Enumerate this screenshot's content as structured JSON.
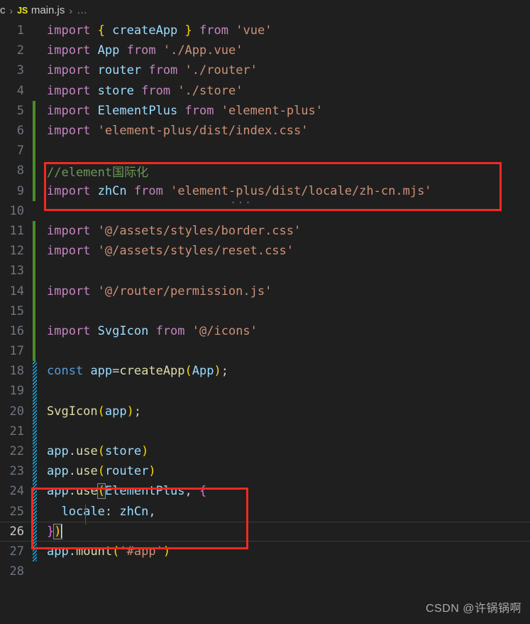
{
  "breadcrumb": {
    "path_prefix": "c",
    "file_icon_label": "JS",
    "file_name": "main.js",
    "separator": "›",
    "trailing": "…"
  },
  "editor": {
    "active_line_number": 26,
    "cursor_line": 26,
    "language": "javascript",
    "theme_background": "#1f1f1f",
    "gutter_green_color": "#4b8b28",
    "gutter_hatch_color": "#1f9ed0",
    "annotation_color": "#f02a21",
    "lines": [
      {
        "n": "1",
        "gutter": "none",
        "text": "import { createApp } from 'vue'"
      },
      {
        "n": "2",
        "gutter": "none",
        "text": "import App from './App.vue'"
      },
      {
        "n": "3",
        "gutter": "none",
        "text": "import router from './router'"
      },
      {
        "n": "4",
        "gutter": "none",
        "text": "import store from './store'"
      },
      {
        "n": "5",
        "gutter": "green",
        "text": "import ElementPlus from 'element-plus'"
      },
      {
        "n": "6",
        "gutter": "green",
        "text": "import 'element-plus/dist/index.css'"
      },
      {
        "n": "7",
        "gutter": "green",
        "text": ""
      },
      {
        "n": "8",
        "gutter": "green",
        "text": "//element国际化"
      },
      {
        "n": "9",
        "gutter": "green",
        "text": "import zhCn from 'element-plus/dist/locale/zh-cn.mjs'"
      },
      {
        "n": "10",
        "gutter": "none",
        "text": ""
      },
      {
        "n": "11",
        "gutter": "green",
        "text": "import '@/assets/styles/border.css'"
      },
      {
        "n": "12",
        "gutter": "green",
        "text": "import '@/assets/styles/reset.css'"
      },
      {
        "n": "13",
        "gutter": "green",
        "text": ""
      },
      {
        "n": "14",
        "gutter": "green",
        "text": "import '@/router/permission.js'"
      },
      {
        "n": "15",
        "gutter": "green",
        "text": ""
      },
      {
        "n": "16",
        "gutter": "green",
        "text": "import SvgIcon from '@/icons'"
      },
      {
        "n": "17",
        "gutter": "green",
        "text": ""
      },
      {
        "n": "18",
        "gutter": "hatch",
        "text": "const app=createApp(App);"
      },
      {
        "n": "19",
        "gutter": "hatch",
        "text": ""
      },
      {
        "n": "20",
        "gutter": "hatch",
        "text": "SvgIcon(app);"
      },
      {
        "n": "21",
        "gutter": "hatch",
        "text": ""
      },
      {
        "n": "22",
        "gutter": "hatch",
        "text": "app.use(store)"
      },
      {
        "n": "23",
        "gutter": "hatch",
        "text": "app.use(router)"
      },
      {
        "n": "24",
        "gutter": "hatch",
        "text": "app.use(ElementPlus, {"
      },
      {
        "n": "25",
        "gutter": "hatch",
        "text": "  locale: zhCn,"
      },
      {
        "n": "26",
        "gutter": "hatch",
        "text": "})"
      },
      {
        "n": "27",
        "gutter": "hatch",
        "text": "app.mount('#app')"
      },
      {
        "n": "28",
        "gutter": "none",
        "text": ""
      }
    ]
  },
  "annotations": [
    {
      "label": "highlight-box-import-zhcn",
      "lines": "8-9"
    },
    {
      "label": "highlight-box-locale-config",
      "lines": "24-26"
    }
  ],
  "watermark": {
    "text": "CSDN @许锅锅啊"
  }
}
